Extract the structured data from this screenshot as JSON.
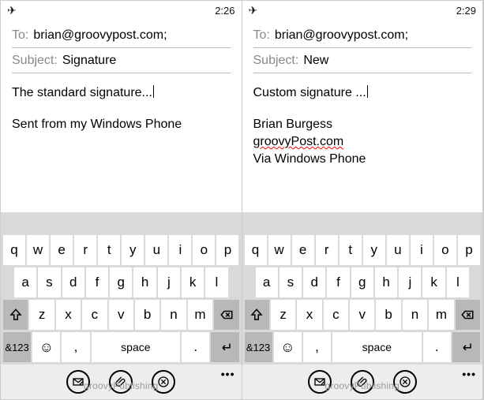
{
  "left": {
    "status": {
      "mode_icon": "✈",
      "time": "2:26"
    },
    "to_label": "To:",
    "to_value": "brian@groovypost.com;",
    "subject_label": "Subject:",
    "subject_value": "Signature",
    "body_line": "The standard signature...",
    "signature_lines": [
      "Sent from my Windows Phone"
    ]
  },
  "right": {
    "status": {
      "mode_icon": "✈",
      "time": "2:29"
    },
    "to_label": "To:",
    "to_value": "brian@groovypost.com;",
    "subject_label": "Subject:",
    "subject_value": "New",
    "body_line": "Custom signature ...",
    "signature_lines": [
      "Brian Burgess",
      "groovyPost.com",
      "Via Windows Phone"
    ],
    "spell_line_index": 1
  },
  "keyboard": {
    "row1": [
      "q",
      "w",
      "e",
      "r",
      "t",
      "y",
      "u",
      "i",
      "o",
      "p"
    ],
    "row2": [
      "a",
      "s",
      "d",
      "f",
      "g",
      "h",
      "j",
      "k",
      "l"
    ],
    "row3": [
      "z",
      "x",
      "c",
      "v",
      "b",
      "n",
      "m"
    ],
    "sym": "&123",
    "space": "space",
    "comma": ",",
    "period": "."
  },
  "watermark": "groovyPublishing"
}
